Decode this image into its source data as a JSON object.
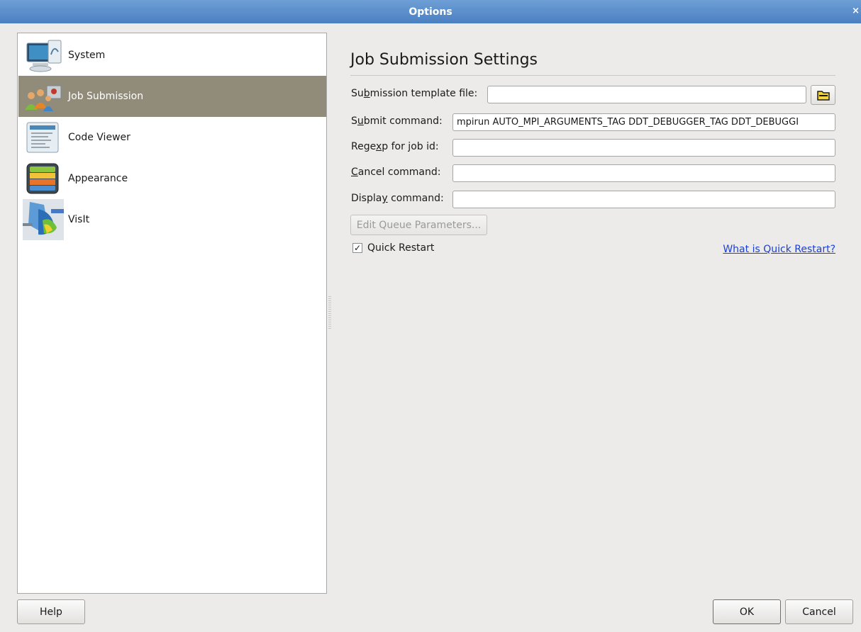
{
  "window": {
    "title": "Options",
    "close_glyph": "×"
  },
  "sidebar": {
    "items": [
      {
        "label": "System",
        "icon": "monitor-icon"
      },
      {
        "label": "Job Submission",
        "icon": "users-icon",
        "selected": true
      },
      {
        "label": "Code Viewer",
        "icon": "document-icon"
      },
      {
        "label": "Appearance",
        "icon": "color-layers-icon"
      },
      {
        "label": "VisIt",
        "icon": "visualization-icon"
      }
    ]
  },
  "panel": {
    "title": "Job Submission Settings",
    "fields": {
      "template_file": {
        "pre": "Su",
        "key": "b",
        "post": "mission template file:",
        "value": ""
      },
      "submit_command": {
        "pre": "S",
        "key": "u",
        "post": "bmit command:",
        "value": "mpirun AUTO_MPI_ARGUMENTS_TAG DDT_DEBUGGER_TAG DDT_DEBUGGI"
      },
      "regexp": {
        "pre": "Rege",
        "key": "x",
        "post": "p for job id:",
        "value": ""
      },
      "cancel_command": {
        "pre": "",
        "key": "C",
        "post": "ancel command:",
        "value": ""
      },
      "display_command": {
        "pre": "Displa",
        "key": "y",
        "post": " command:",
        "value": ""
      }
    },
    "edit_queue_label": "Edit Queue Parameters...",
    "quick_restart_label": "Quick Restart",
    "quick_restart_checked": "✓",
    "quick_restart_link": "What is Quick Restart?"
  },
  "footer": {
    "help_label": "Help",
    "ok_label": "OK",
    "cancel_label": "Cancel"
  },
  "colors": {
    "titlebar": "#4a7fc1",
    "selection": "#918b79",
    "link": "#1a3fd6"
  }
}
